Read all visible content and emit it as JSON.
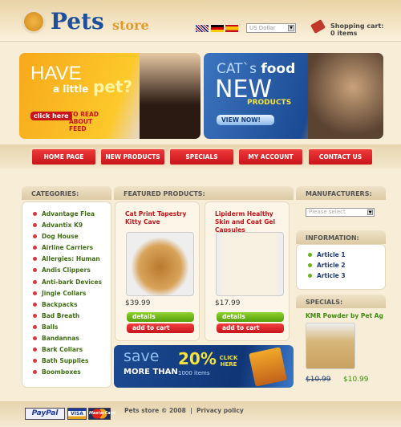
{
  "header": {
    "logo_main": "Pets",
    "logo_sub": "store",
    "languages": [
      "English",
      "Deutsch",
      "Español"
    ],
    "currency": "US Dollar",
    "cart_label": "Shopping cart:",
    "cart_count": "0 items"
  },
  "banners": {
    "left": {
      "line1": "HAVE",
      "line2": "a little",
      "line3": "pet?",
      "button": "click here",
      "caption": "TO READ ABOUT FEED"
    },
    "right": {
      "line1": "CAT`s",
      "line1b": "food",
      "line2": "NEW",
      "line3": "PRODUCTS",
      "button": "VIEW NOW!"
    }
  },
  "nav": [
    "HOME PAGE",
    "NEW PRODUCTS",
    "SPECIALS",
    "MY ACCOUNT",
    "CONTACT US"
  ],
  "categories": {
    "title": "CATEGORIES:",
    "items": [
      "Advantage Flea",
      "Advantix K9",
      "Dog House",
      "Airline Carriers",
      "Allergies: Human",
      "Andis Clippers",
      "Anti-bark Devices",
      "Jingle Collars",
      "Backpacks",
      "Bad Breath",
      "Balls",
      "Bandannas",
      "Bark Collars",
      "Bath Supplies",
      "Boomboxes"
    ]
  },
  "featured": {
    "title": "FEATURED PRODUCTS:",
    "products": [
      {
        "name": "Cat Print Tapestry Kitty Cave",
        "price": "$39.99",
        "details": "details",
        "add": "add to cart"
      },
      {
        "name": "Lipiderm Healthy Skin and Coat Gel Capsules",
        "price": "$17.99",
        "details": "details",
        "add": "add to cart"
      }
    ]
  },
  "promo": {
    "save": "save",
    "more": "MORE THAN",
    "percent": "20%",
    "items": "1000 items",
    "click": "CLICK HERE"
  },
  "manufacturers": {
    "title": "MANUFACTURERS:",
    "placeholder": "Please select"
  },
  "information": {
    "title": "INFORMATION:",
    "items": [
      "Article 1",
      "Article 2",
      "Article 3"
    ]
  },
  "specials": {
    "title": "SPECIALS:",
    "name": "KMR Powder by Pet Ag",
    "old_price": "$10.99",
    "new_price": "$10.99"
  },
  "footer": {
    "copyright": "Pets store © 2008",
    "separator": "|",
    "privacy": "Privacy policy",
    "payments": [
      "PayPal",
      "VISA",
      "MasterCard"
    ]
  }
}
